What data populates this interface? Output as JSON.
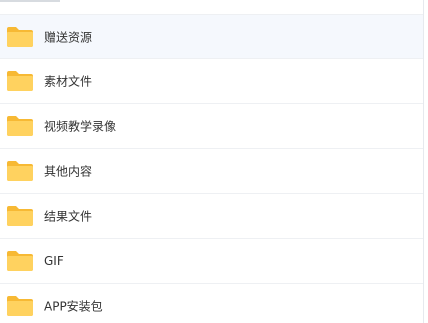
{
  "file_list": {
    "items": [
      {
        "name": "赠送资源",
        "icon": "folder-icon"
      },
      {
        "name": "素材文件",
        "icon": "folder-icon"
      },
      {
        "name": "视频教学录像",
        "icon": "folder-icon"
      },
      {
        "name": "其他内容",
        "icon": "folder-icon"
      },
      {
        "name": "结果文件",
        "icon": "folder-icon"
      },
      {
        "name": "GIF",
        "icon": "folder-icon"
      },
      {
        "name": "APP安装包",
        "icon": "folder-icon"
      }
    ]
  },
  "colors": {
    "folder_body": "#FFD25F",
    "folder_tab": "#F7B934",
    "selected_row_bg": "#F5F8FD",
    "row_divider": "#EEF0F3",
    "text": "#333333"
  }
}
